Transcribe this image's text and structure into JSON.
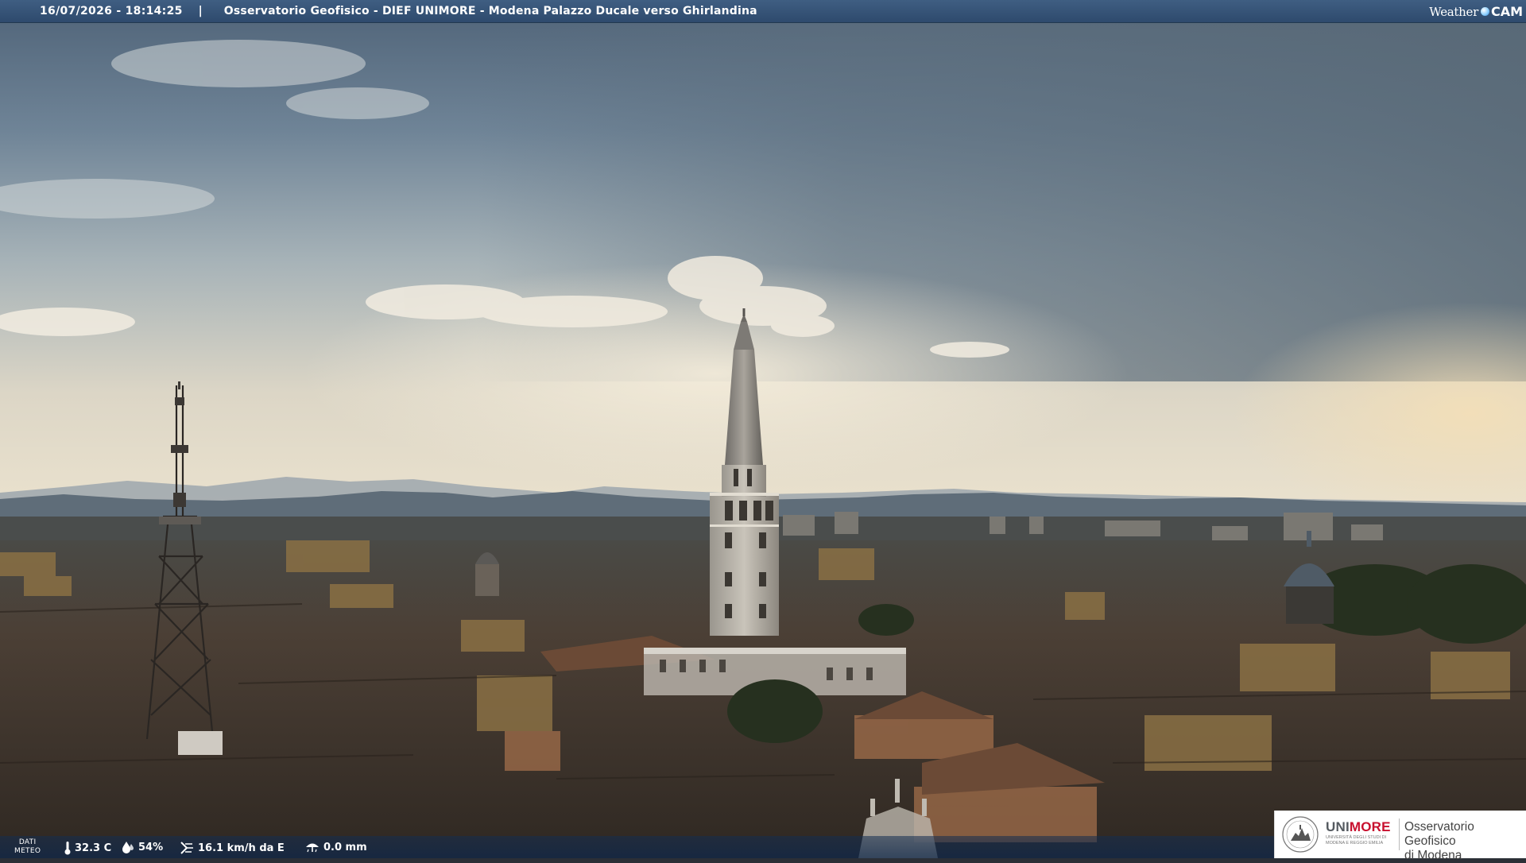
{
  "header": {
    "timestamp": "16/07/2026 - 18:14:25",
    "separator": "|",
    "title": "Osservatorio Geofisico - DIEF UNIMORE - Modena Palazzo Ducale verso Ghirlandina",
    "brand": {
      "weather_text": "Weather",
      "cam_text": "CAM"
    }
  },
  "weather_bar": {
    "tag_line1": "DATI",
    "tag_line2": "METEO",
    "temperature": "32.3 C",
    "humidity": "54%",
    "wind": "16.1 km/h da E",
    "rain": "0.0 mm",
    "icons": {
      "temperature": "thermometer-icon",
      "humidity": "humidity-drop-icon",
      "wind": "wind-icon",
      "rain": "rain-icon"
    }
  },
  "logo": {
    "uni_part1": "UNI",
    "uni_part2": "MORE",
    "uni_subtitle": "Università degli Studi di Modena e Reggio Emilia",
    "observatory_line1": "Osservatorio Geofisico",
    "observatory_line2": "di Modena"
  },
  "colors": {
    "header_bar": "#34527a",
    "unimore_red": "#c8102e",
    "sky_top": "#5c7187",
    "sky_glow": "#efe6d2",
    "rooftops": "#3e342c"
  }
}
